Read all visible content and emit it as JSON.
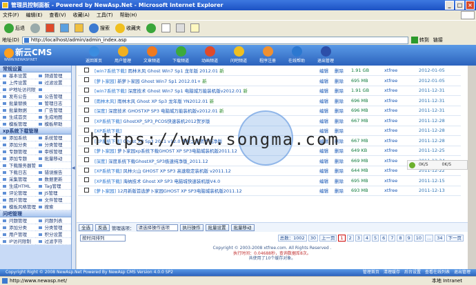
{
  "window": {
    "title": "管理员控制面板 - Powered by NewAsp.Net - Microsoft Internet Explorer"
  },
  "menu": [
    "文件(F)",
    "编辑(E)",
    "查看(V)",
    "收藏(A)",
    "工具(T)",
    "帮助(H)"
  ],
  "toolbar": {
    "back": "后退",
    "search": "搜索",
    "favorites": "收藏夹"
  },
  "address": {
    "label": "地址(D)",
    "url": "http://localhost/admin/admin_index.asp",
    "go": "转到",
    "links": "链接"
  },
  "logo": {
    "name": "新云CMS",
    "sub": "WWW.NEWASP.NET"
  },
  "topnav": [
    {
      "label": "返回首页",
      "color": "#3c8de0"
    },
    {
      "label": "用户管理",
      "color": "#f0b020"
    },
    {
      "label": "文章频道",
      "color": "#f07a20"
    },
    {
      "label": "下载频道",
      "color": "#3caa3c"
    },
    {
      "label": "动画频道",
      "color": "#e04a2a"
    },
    {
      "label": "问吧频道",
      "color": "#f0c020"
    },
    {
      "label": "程序注册",
      "color": "#f09030"
    },
    {
      "label": "在线帮助",
      "color": "#2c78d0"
    },
    {
      "label": "退出管理",
      "color": "#2c4fa8"
    }
  ],
  "sidebar": {
    "sections": [
      {
        "title": "常规设置",
        "items": [
          "基本设置",
          "频道管理",
          "上传设置",
          "过滤设置",
          "IP地址访问限制管理",
          "",
          "发布公告",
          "公告管理",
          "批量替换",
          "管理日志",
          "批量数据",
          "广告管理",
          "生成首页",
          "生成地图",
          "模板管理",
          "模板帮助"
        ]
      },
      {
        "title": "xp系统下载管理",
        "items": [
          "添加系统",
          "系统管理",
          "添加分类",
          "分类管理",
          "专题管理",
          "审核管理",
          "添加专题",
          "批量移动",
          "下载服务器管理",
          "",
          "下载日志",
          "错误报告",
          "采集管理",
          "数据更新",
          "生成HTML",
          "Tag管理",
          "评论管理",
          "JS管理",
          "图片管理",
          "文件管理",
          "模板风格管理",
          "搜索"
        ]
      },
      {
        "title": "问吧管理",
        "items": [
          "问题管理",
          "问题列表",
          "添加分类",
          "分类管理",
          "用户管理",
          "积分设置",
          "IP访问限制",
          "过滤字符"
        ]
      }
    ]
  },
  "rows": [
    {
      "cat": "[win7系统下载]",
      "title": "雨林木风 Ghost Win7 Sp1 龙年版 2012.01",
      "suffix": "新",
      "size": "1.91 GB",
      "author": "xtfree",
      "date": "2012-01-05"
    },
    {
      "cat": "[萝卜家园]",
      "title": "新萝卜家园 Ghost Win7 Sp1 2012.01+",
      "suffix": "新",
      "size": "695 MB",
      "author": "xtfree",
      "date": "2012-01-05"
    },
    {
      "cat": "[win7系统下载]",
      "title": "深度技术 Ghost Win7 Sp1 电脑城万能装机版v2012.01",
      "suffix": "新",
      "size": "1.91 GB",
      "author": "xtfree",
      "date": "2011-12-31"
    },
    {
      "cat": "[雨林木风]",
      "title": "雨林木风 Ghost XP Sp3 龙年版 YN2012.01",
      "suffix": "新",
      "size": "696 MB",
      "author": "xtfree",
      "date": "2011-12-31"
    },
    {
      "cat": "[深度]",
      "title": "深度技术 GHOSTXP SP3 电脑城万能装机版v2012.01",
      "suffix": "新",
      "size": "696 MB",
      "author": "xtfree",
      "date": "2011-12-31"
    },
    {
      "cat": "[XP系统下载]",
      "title": "GhostXP_SP3_PCOS快速装机2012贺岁版",
      "suffix": "",
      "size": "667 MB",
      "author": "xtfree",
      "date": "2011-12-28"
    },
    {
      "cat": "[XP系统下载]",
      "title": "",
      "suffix": "",
      "size": "",
      "author": "xtfree",
      "date": "2011-12-28"
    },
    {
      "cat": "[XP系统下载]",
      "title": "Ghost XP Sp3 2011 v12.0 系统之家贺岁纯净版",
      "suffix": "",
      "size": "667 MB",
      "author": "xtfree",
      "date": "2011-12-28"
    },
    {
      "cat": "[萝卜家园]",
      "title": "萝卜家园xp系统下载GHOST XP SP3电脑城装机版2011.12",
      "suffix": "",
      "size": "649 KB",
      "author": "xtfree",
      "date": "2011-12-25"
    },
    {
      "cat": "[深度]",
      "title": "深度系统下载GhostXP_SP3极速纯净版_2011.12",
      "suffix": "",
      "size": "669 MB",
      "author": "xtfree",
      "date": "2011-12-24"
    },
    {
      "cat": "[XP系统下载]",
      "title": "风林火山 GHOST XP SP3 高速稳定装机版 v2011.12",
      "suffix": "",
      "size": "644 MB",
      "author": "xtfree",
      "date": "2011-12-22"
    },
    {
      "cat": "[XP系统下载]",
      "title": "海纳技术 Ghost XP SP3 电脑城快速装机版V4.0",
      "suffix": "",
      "size": "695 MB",
      "author": "xtfree",
      "date": "2011-12-15"
    },
    {
      "cat": "[萝卜家园]",
      "title": "12月新版首选萝卜家园GHOST XP SP3电脑城装机版2011.12",
      "suffix": "",
      "size": "693 MB",
      "author": "xtfree",
      "date": "2011-12-13"
    }
  ],
  "row_actions": {
    "edit": "编辑",
    "delete": "删除"
  },
  "actions": {
    "select_all": "全选",
    "invert": "反选",
    "manage_label": "管理选项：",
    "manage_select": "请选择操作选项",
    "execute": "执行操作",
    "batch_set": "批量设置",
    "batch_move": "批量移动"
  },
  "sort": {
    "select": "按时间排列"
  },
  "pager": {
    "total": "总数：1002",
    "per": "30",
    "prev": "上一页",
    "pages": [
      "1",
      "2",
      "3",
      "4",
      "5",
      "6",
      "7",
      "8",
      "9",
      "10",
      "...",
      "34"
    ],
    "next": "下一页"
  },
  "copyright": {
    "line1": "Copyright © 2003-2008 xtfree.com. All Rights Reserved .",
    "line2": "执行时间：0.04688秒，查询数据库8次。",
    "line3": "共使用了10个缓存对象。"
  },
  "cmsfooter": {
    "text": "Copyright Right © 2008 NewAsp.Net Powered By NewAsp CMS Version 4.0.0 SP2",
    "links": [
      "管理首页",
      "清理缓存",
      "后台设置",
      "查看在线列表",
      "退出管理"
    ]
  },
  "status": {
    "url": "http://www.newasp.net/",
    "zone": "本地 Intranet"
  },
  "watermark": "https://www.songma.com",
  "net": {
    "up": "0K/S",
    "down": "0K/S"
  }
}
